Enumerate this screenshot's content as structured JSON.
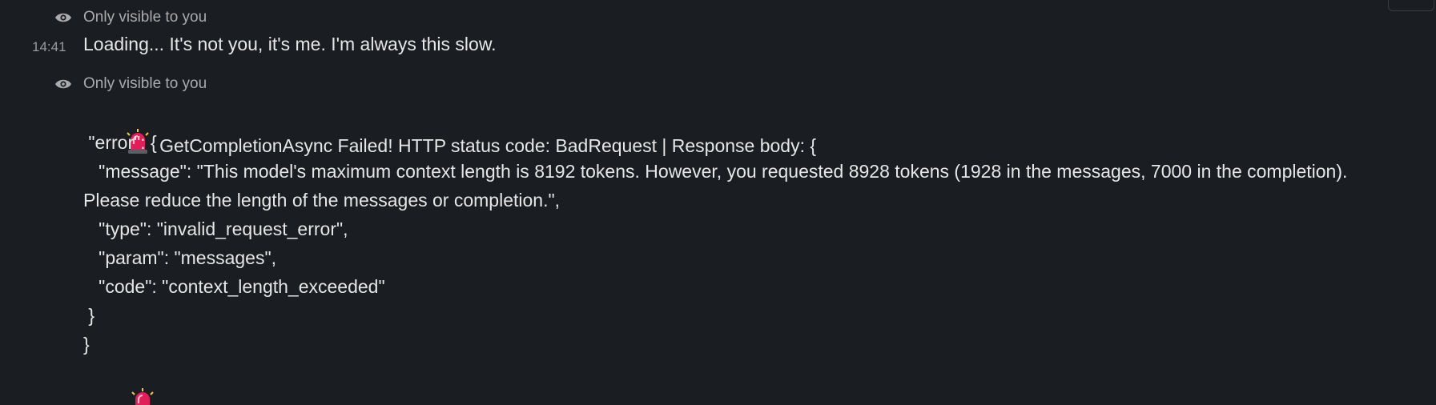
{
  "messages": [
    {
      "visibility_label": "Only visible to you",
      "timestamp": "14:41",
      "text": "Loading... It's not you, it's me. I'm always this slow."
    },
    {
      "visibility_label": "Only visible to you",
      "error_header": "GetCompletionAsync Failed! HTTP status code: BadRequest | Response body: {",
      "json_lines": [
        " \"error\": {",
        "   \"message\": \"This model's maximum context length is 8192 tokens. However, you requested 8928 tokens (1928 in the messages, 7000 in the completion).",
        "Please reduce the length of the messages or completion.\",",
        "   \"type\": \"invalid_request_error\",",
        "   \"param\": \"messages\",",
        "   \"code\": \"context_length_exceeded\"",
        " }",
        "}"
      ]
    }
  ],
  "icons": {
    "visibility": "eye-icon",
    "siren": "police-light-siren-icon"
  },
  "colors": {
    "background": "#1a1d21",
    "text": "#e6e6e7",
    "muted": "#ababad",
    "siren_red": "#e01e5a"
  }
}
